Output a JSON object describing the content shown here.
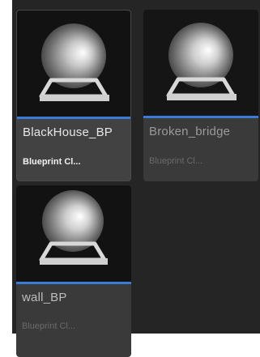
{
  "assets": [
    {
      "name": "BlackHouse_BP",
      "type": "Blueprint Cl...",
      "selected": true
    },
    {
      "name": "Broken_bridge",
      "type": "Blueprint Cl...",
      "selected": false
    },
    {
      "name": "wall_BP",
      "type": "Blueprint Cl...",
      "selected": false
    }
  ],
  "icon": "material-sphere-on-pedestal-icon",
  "colors": {
    "accent": "#3a7bd5",
    "panel_background": "#252525",
    "tile_background": "#3a3a3a",
    "thumbnail_background": "#121212"
  }
}
